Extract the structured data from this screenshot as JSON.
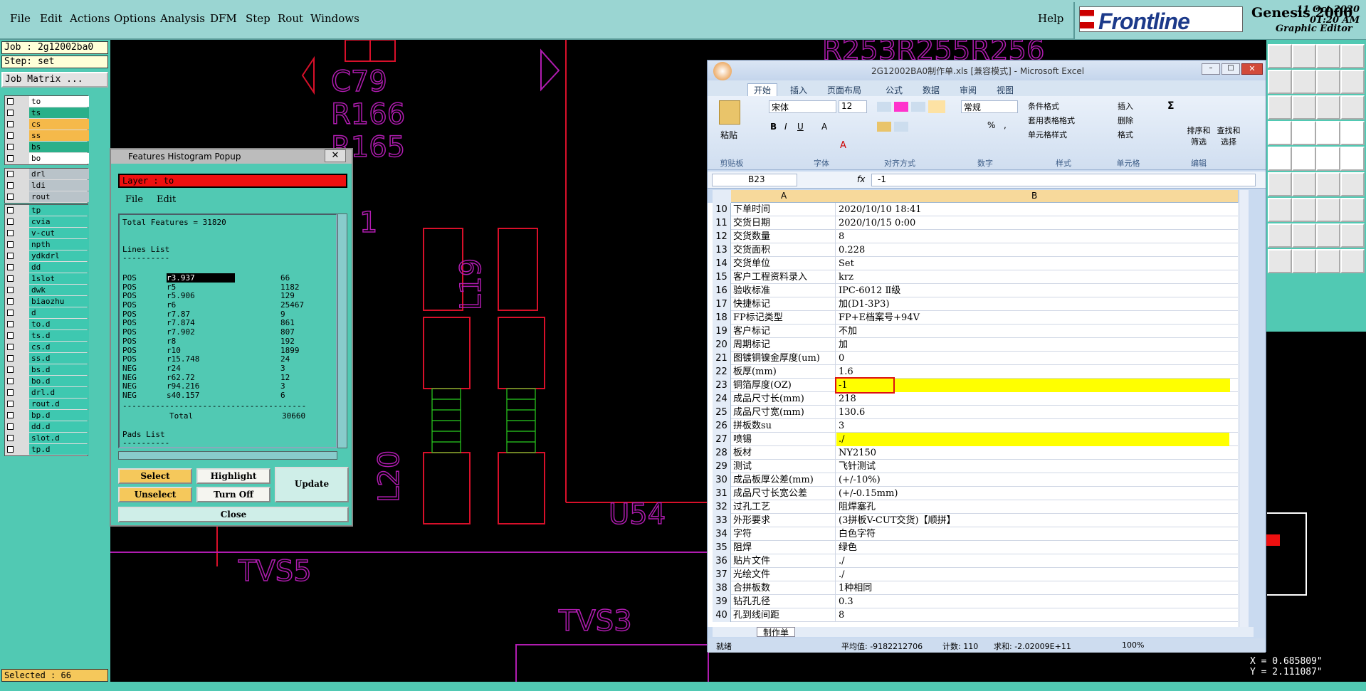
{
  "menu": {
    "items": [
      "File",
      "Edit",
      "Actions",
      "Options",
      "Analysis",
      "DFM",
      "Step",
      "Rout",
      "Windows"
    ],
    "help": "Help"
  },
  "brand": {
    "logo": "Frontline",
    "product": "Genesis 2000",
    "subtitle": "Graphic Editor",
    "date": "11 Oct 2020",
    "time": "01:20 AM"
  },
  "job": {
    "job_label": "Job : 2g12002ba0",
    "step_label": "Step: set",
    "matrix_button": "Job Matrix ..."
  },
  "layers": {
    "group1": [
      {
        "name": "to",
        "color": "#ffffff"
      },
      {
        "name": "ts",
        "color": "#2ab08a"
      },
      {
        "name": "cs",
        "color": "#f5b94a"
      },
      {
        "name": "ss",
        "color": "#f5b94a"
      },
      {
        "name": "bs",
        "color": "#2ab08a"
      },
      {
        "name": "bo",
        "color": "#ffffff"
      }
    ],
    "group2": [
      {
        "name": "drl",
        "color": "#b9c3c9"
      },
      {
        "name": "ldi",
        "color": "#b9c3c9"
      },
      {
        "name": "rout",
        "color": "#b9c3c9"
      }
    ],
    "group3": [
      {
        "name": "tp",
        "color": "#3ec8b0"
      },
      {
        "name": "cvia",
        "color": "#3ec8b0"
      },
      {
        "name": "v-cut",
        "color": "#3ec8b0"
      },
      {
        "name": "npth",
        "color": "#3ec8b0"
      },
      {
        "name": "ydkdrl",
        "color": "#3ec8b0"
      },
      {
        "name": "dd",
        "color": "#3ec8b0"
      },
      {
        "name": "1slot",
        "color": "#3ec8b0"
      },
      {
        "name": "dwk",
        "color": "#3ec8b0"
      },
      {
        "name": "biaozhu",
        "color": "#3ec8b0"
      },
      {
        "name": "d",
        "color": "#3ec8b0"
      },
      {
        "name": "to.d",
        "color": "#3ec8b0"
      },
      {
        "name": "ts.d",
        "color": "#3ec8b0"
      },
      {
        "name": "cs.d",
        "color": "#3ec8b0"
      },
      {
        "name": "ss.d",
        "color": "#3ec8b0"
      },
      {
        "name": "bs.d",
        "color": "#3ec8b0"
      },
      {
        "name": "bo.d",
        "color": "#3ec8b0"
      },
      {
        "name": "drl.d",
        "color": "#3ec8b0"
      },
      {
        "name": "rout.d",
        "color": "#3ec8b0"
      },
      {
        "name": "bp.d",
        "color": "#3ec8b0"
      },
      {
        "name": "dd.d",
        "color": "#3ec8b0"
      },
      {
        "name": "slot.d",
        "color": "#3ec8b0"
      },
      {
        "name": "tp.d",
        "color": "#3ec8b0"
      }
    ]
  },
  "selected_label": "Selected : 66",
  "board_labels": [
    "R253R255R256",
    "C79",
    "R166",
    "R165",
    "L19",
    "L20",
    "U54",
    "TVS5",
    "TVS3",
    "1"
  ],
  "histogram": {
    "title": "Features Histogram Popup",
    "layer_label": "Layer :  to",
    "menu": [
      "File",
      "Edit"
    ],
    "total": "Total Features = 31820",
    "lines_heading": "Lines List",
    "rule": "----------",
    "rows": [
      [
        "POS",
        "r3.937",
        "66"
      ],
      [
        "POS",
        "r5",
        "1182"
      ],
      [
        "POS",
        "r5.906",
        "129"
      ],
      [
        "POS",
        "r6",
        "25467"
      ],
      [
        "POS",
        "r7.87",
        "9"
      ],
      [
        "POS",
        "r7.874",
        "861"
      ],
      [
        "POS",
        "r7.902",
        "807"
      ],
      [
        "POS",
        "r8",
        "192"
      ],
      [
        "POS",
        "r10",
        "1899"
      ],
      [
        "POS",
        "r15.748",
        "24"
      ],
      [
        "NEG",
        "r24",
        "3"
      ],
      [
        "NEG",
        "r62.72",
        "12"
      ],
      [
        "NEG",
        "r94.216",
        "3"
      ],
      [
        "NEG",
        "s40.157",
        "6"
      ]
    ],
    "long_rule": "---------------------------------------",
    "total_label": "Total",
    "total_value": "30660",
    "pads_heading": "Pads List",
    "buttons": {
      "select": "Select",
      "highlight": "Highlight",
      "update": "Update",
      "unselect": "Unselect",
      "turn_off": "Turn Off",
      "close": "Close"
    }
  },
  "excel": {
    "title": "2G12002BA0制作单.xls [兼容模式] - Microsoft Excel",
    "tabs": [
      "开始",
      "插入",
      "页面布局",
      "公式",
      "数据",
      "审阅",
      "视图"
    ],
    "font_name": "宋体",
    "font_size": "12",
    "number_format": "常规",
    "groups": [
      "剪贴板",
      "字体",
      "对齐方式",
      "数字",
      "样式",
      "单元格",
      "编辑"
    ],
    "ribbon_labels": {
      "paste": "粘贴",
      "cond_format": "条件格式",
      "table_format": "套用表格格式",
      "cell_style": "单元格样式",
      "insert": "插入",
      "delete": "删除",
      "format": "格式",
      "sort": "排序和\n筛选",
      "find": "查找和\n选择",
      "percent": "%",
      "comma": ","
    },
    "name_box": "B23",
    "fx": "fx",
    "formula": "-1",
    "col_a": "A",
    "col_b": "B",
    "rows": [
      {
        "n": "10",
        "a": "下单时间",
        "b": "2020/10/10 18:41"
      },
      {
        "n": "11",
        "a": "交货日期",
        "b": "2020/10/15 0:00"
      },
      {
        "n": "12",
        "a": "交货数量",
        "b": "8"
      },
      {
        "n": "13",
        "a": "交货面积",
        "b": "0.228"
      },
      {
        "n": "14",
        "a": "交货单位",
        "b": "Set"
      },
      {
        "n": "15",
        "a": "客户工程资料录入",
        "b": "krz"
      },
      {
        "n": "16",
        "a": "验收标准",
        "b": "IPC-6012 Ⅱ级"
      },
      {
        "n": "17",
        "a": "快捷标记",
        "b": "加(D1-3P3)"
      },
      {
        "n": "18",
        "a": "FP标记类型",
        "b": "FP+E档案号+94V"
      },
      {
        "n": "19",
        "a": "客户标记",
        "b": "不加"
      },
      {
        "n": "20",
        "a": "周期标记",
        "b": "加"
      },
      {
        "n": "21",
        "a": "图镀铜镍金厚度(um)",
        "b": "0"
      },
      {
        "n": "22",
        "a": "板厚(mm)",
        "b": "1.6"
      },
      {
        "n": "23",
        "a": "铜箔厚度(OZ)",
        "b": "-1",
        "hl": true
      },
      {
        "n": "24",
        "a": "成品尺寸长(mm)",
        "b": "218"
      },
      {
        "n": "25",
        "a": "成品尺寸宽(mm)",
        "b": "130.6"
      },
      {
        "n": "26",
        "a": "拼板数su",
        "b": "3"
      },
      {
        "n": "27",
        "a": "喷锡",
        "b": "./",
        "hl": true
      },
      {
        "n": "28",
        "a": "板材",
        "b": "NY2150"
      },
      {
        "n": "29",
        "a": "测试",
        "b": "飞针测试"
      },
      {
        "n": "30",
        "a": "成品板厚公差(mm)",
        "b": "(+/-10%)"
      },
      {
        "n": "31",
        "a": "成品尺寸长宽公差",
        "b": "(+/-0.15mm)"
      },
      {
        "n": "32",
        "a": "过孔工艺",
        "b": "阻焊塞孔"
      },
      {
        "n": "33",
        "a": "外形要求",
        "b": "(3拼板V-CUT交货)【顺拼】"
      },
      {
        "n": "34",
        "a": "字符",
        "b": "白色字符"
      },
      {
        "n": "35",
        "a": "阻焊",
        "b": "绿色"
      },
      {
        "n": "36",
        "a": "贴片文件",
        "b": "./"
      },
      {
        "n": "37",
        "a": "光绘文件",
        "b": "./"
      },
      {
        "n": "38",
        "a": "合拼板数",
        "b": "1种相同"
      },
      {
        "n": "39",
        "a": "钻孔孔径",
        "b": "0.3"
      },
      {
        "n": "40",
        "a": "孔到线间距",
        "b": "8"
      }
    ],
    "sheet_tab": "制作单",
    "status": {
      "ready": "就绪",
      "average": "平均值: -9182212706",
      "count": "计数: 110",
      "sum": "求和: -2.02009E+11",
      "zoom": "100%"
    }
  },
  "coords": {
    "x": "X = 0.685809\"",
    "y": "Y = 2.111087\""
  },
  "colors": {
    "panel": "#51c9b3",
    "menubar": "#9ad5d2",
    "board_red": "#d8102a",
    "board_magenta": "#b01cb0",
    "excel_highlight": "#ffff00"
  }
}
